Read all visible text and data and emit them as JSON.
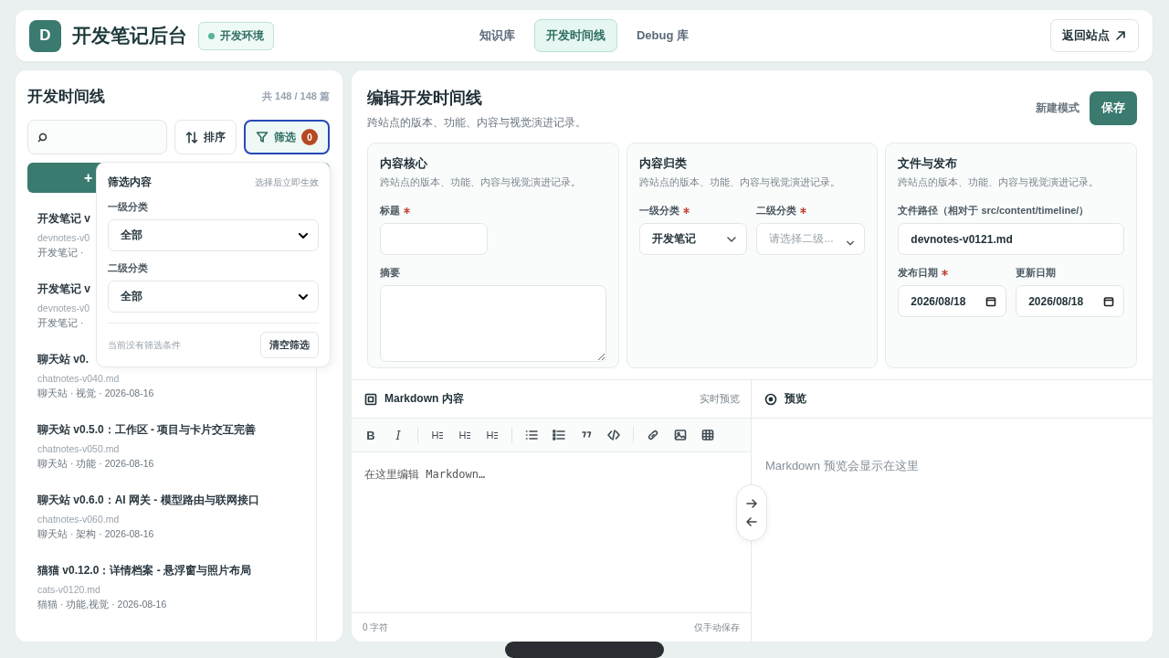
{
  "header": {
    "logo": "D",
    "title": "开发笔记后台",
    "env_badge": "开发环境",
    "tabs": [
      {
        "label": "知识库",
        "selected": false
      },
      {
        "label": "开发时间线",
        "selected": true
      },
      {
        "label": "Debug 库",
        "selected": false
      }
    ],
    "return_button": "返回站点"
  },
  "sidebar": {
    "title": "开发时间线",
    "count": "共 148 / 148 篇",
    "sort_button": "排序",
    "filter_button": {
      "label": "筛选",
      "badge": "0",
      "open": true
    },
    "add_button": "+",
    "items": [
      {
        "title": "开发笔记 v",
        "file": "devnotes-v0",
        "meta": "开发笔记 ·"
      },
      {
        "title": "开发笔记 v",
        "file": "devnotes-v0",
        "meta": "开发笔记 ·"
      },
      {
        "title": "聊天站 v0.",
        "file": "chatnotes-v040.md",
        "meta": "聊天站 · 视觉 · 2026-08-16"
      },
      {
        "title": "聊天站 v0.5.0：工作区 - 项目与卡片交互完善",
        "file": "chatnotes-v050.md",
        "meta": "聊天站 · 功能 · 2026-08-16"
      },
      {
        "title": "聊天站 v0.6.0：AI 网关 - 模型路由与联网接口",
        "file": "chatnotes-v060.md",
        "meta": "聊天站 · 架构 · 2026-08-16"
      },
      {
        "title": "猫猫 v0.12.0：详情档案 - 悬浮窗与照片布局",
        "file": "cats-v0120.md",
        "meta": "猫猫 · 功能,视觉 · 2026-08-16"
      }
    ],
    "filter_popover": {
      "title": "筛选内容",
      "hint": "选择后立即生效",
      "fields": [
        {
          "label": "一级分类",
          "value": "全部"
        },
        {
          "label": "二级分类",
          "value": "全部"
        }
      ],
      "status": "当前没有筛选条件",
      "clear_button": "清空筛选"
    }
  },
  "editor": {
    "title": "编辑开发时间线",
    "subtitle": "跨站点的版本、功能、内容与视觉演进记录。",
    "mode": "新建模式",
    "save_button": "保存",
    "sections": [
      {
        "title": "内容核心",
        "subtitle": "跨站点的版本、功能、内容与视觉演进记录。",
        "fields": [
          {
            "kind": "text",
            "label": "标题",
            "required": true
          },
          {
            "kind": "textarea",
            "label": "摘要",
            "required": false
          }
        ]
      },
      {
        "title": "内容归类",
        "subtitle": "跨站点的版本、功能、内容与视觉演进记录。",
        "fields": [
          {
            "kind": "select",
            "label": "一级分类",
            "required": true,
            "value": "开发笔记"
          },
          {
            "kind": "select",
            "label": "二级分类",
            "required": true,
            "placeholder": "请选择二级..."
          }
        ]
      },
      {
        "title": "文件与发布",
        "subtitle": "跨站点的版本、功能、内容与视觉演进记录。",
        "fields": [
          {
            "kind": "path",
            "label": "文件路径（相对于 src/content/timeline/）",
            "required": false,
            "value": "devnotes-v0121.md"
          },
          {
            "kind": "date",
            "label": "发布日期",
            "required": true,
            "value": "2026/08/18"
          },
          {
            "kind": "date",
            "label": "更新日期",
            "required": false,
            "value": "2026/08/18"
          }
        ]
      }
    ]
  },
  "markdown": {
    "title": "Markdown 内容",
    "live_label": "实时预览",
    "toolbar": [
      {
        "kind": "bold",
        "label": "B"
      },
      {
        "kind": "italic",
        "label": "I"
      },
      {
        "kind": "separator"
      },
      {
        "kind": "heading",
        "label": "H"
      },
      {
        "kind": "heading",
        "label": "H"
      },
      {
        "kind": "heading",
        "label": "H"
      },
      {
        "kind": "separator"
      },
      {
        "kind": "bullet-list"
      },
      {
        "kind": "numbered-list"
      },
      {
        "kind": "quote"
      },
      {
        "kind": "code"
      },
      {
        "kind": "separator"
      },
      {
        "kind": "link"
      },
      {
        "kind": "image"
      },
      {
        "kind": "table"
      }
    ],
    "placeholder": "在这里编辑 Markdown…",
    "char_count": "0 字符",
    "save_note": "仅手动保存"
  },
  "preview": {
    "title": "预览",
    "empty_message": "Markdown 预览会显示在这里"
  }
}
